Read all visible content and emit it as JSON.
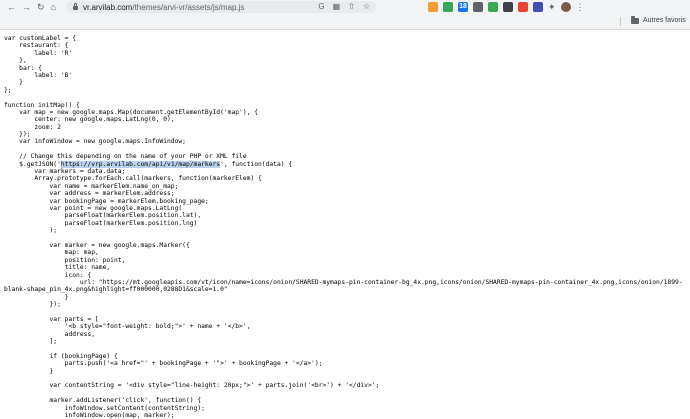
{
  "browser": {
    "url_host": "vr.arvilab.com",
    "url_path": "/themes/arvi-vr/assets/js/map.js",
    "icons": {
      "back": "back-arrow-icon",
      "forward": "forward-arrow-icon",
      "reload": "reload-icon",
      "home": "home-icon",
      "google": "google-icon",
      "translate": "translate-icon",
      "share": "share-icon",
      "bookmark": "star-icon"
    },
    "extension_colors": [
      "#f29d38",
      "#34a853",
      "#1a73e8",
      "#5f6368",
      "#34a853",
      "#3c4043",
      "#ea4335",
      "#3f51b5"
    ],
    "extension_badge": "18",
    "bookmarks_folder_label": "Autres favoris"
  },
  "code": {
    "lines": [
      "var customLabel = {",
      "    restaurant: {",
      "        label: 'R'",
      "    },",
      "    bar: {",
      "        label: 'B'",
      "    }",
      "};",
      "",
      "function initMap() {",
      "    var map = new google.maps.Map(document.getElementById('map'), {",
      "        center: new google.maps.LatLng(0, 0),",
      "        zoom: 2",
      "    });",
      "    var infoWindow = new google.maps.InfoWindow;",
      "",
      "    // Change this depending on the name of your PHP or XML file",
      "    $.getJSON('https://vrp.arvilab.com/api/v1/map/markers', function(data) {",
      "        var markers = data.data;",
      "        Array.prototype.forEach.call(markers, function(markerElem) {",
      "            var name = markerElem.name_on_map;",
      "            var address = markerElem.address;",
      "            var bookingPage = markerElem.booking_page;",
      "            var point = new google.maps.LatLng(",
      "                parseFloat(markerElem.position.lat),",
      "                parseFloat(markerElem.position.lng)",
      "            );",
      "",
      "            var marker = new google.maps.Marker({",
      "                map: map,",
      "                position: point,",
      "                title: name,",
      "                icon: {",
      "                    url: \"https://mt.googleapis.com/vt/icon/name=icons/onion/SHARED-mymaps-pin-container-bg_4x.png,icons/onion/SHARED-mymaps-pin-container_4x.png,icons/onion/1899-",
      "blank-shape_pin_4x.png&highlight=ff000000,0288D1&scale=1.0\"",
      "                }",
      "            });",
      "",
      "            var parts = [",
      "                '<b style=\"font-weight: bold;\">' + name + '</b>',",
      "                address,",
      "            ];",
      "",
      "            if (bookingPage) {",
      "                parts.push('<a href=\"' + bookingPage + '\">' + bookingPage + '</a>');",
      "            }",
      "",
      "            var contentString = '<div style=\"line-height: 20px;\">' + parts.join('<br>') + '</div>';",
      "",
      "            marker.addListener('click', function() {",
      "                infoWindow.setContent(contentString);",
      "                infoWindow.open(map, marker);"
    ],
    "highlighted_text": "https://vrp.arvilab.com/api/v1/map/markers"
  }
}
